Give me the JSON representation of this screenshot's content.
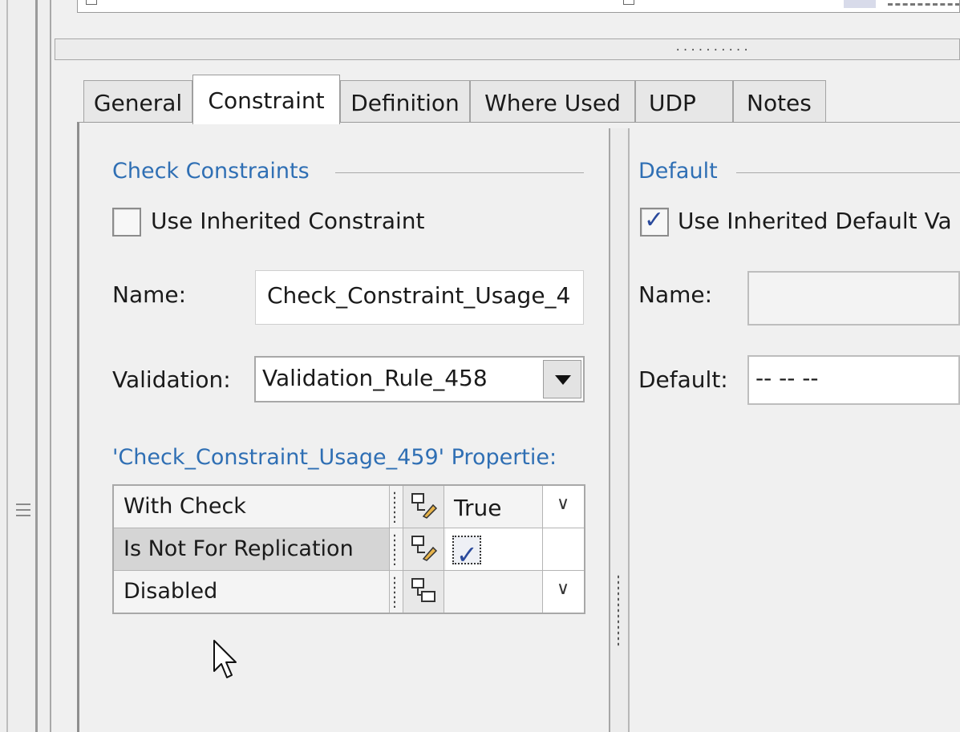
{
  "tabs": [
    {
      "label": "General"
    },
    {
      "label": "Constraint"
    },
    {
      "label": "Definition"
    },
    {
      "label": "Where Used"
    },
    {
      "label": "UDP"
    },
    {
      "label": "Notes"
    }
  ],
  "active_tab": "Constraint",
  "check_constraints": {
    "title": "Check Constraints",
    "use_inherited_label": "Use Inherited Constraint",
    "use_inherited_checked": false,
    "name_label": "Name:",
    "name_value": "Check_Constraint_Usage_4",
    "validation_label": "Validation:",
    "validation_value": "Validation_Rule_458",
    "properties_title": "'Check_Constraint_Usage_459' Propertie:",
    "properties": [
      {
        "name": "With Check",
        "value": "True",
        "has_dropdown": true
      },
      {
        "name": "Is Not For Replication",
        "checked": true,
        "selected": true
      },
      {
        "name": "Disabled",
        "value": "",
        "has_dropdown": true
      }
    ]
  },
  "default": {
    "title": "Default",
    "use_inherited_label": "Use Inherited Default Va",
    "use_inherited_checked": true,
    "name_label": "Name:",
    "name_value": "",
    "default_label": "Default:",
    "default_value": "-- -- --"
  },
  "colors": {
    "section_title": "#2f6fb4",
    "check_mark": "#2a4a9c"
  }
}
